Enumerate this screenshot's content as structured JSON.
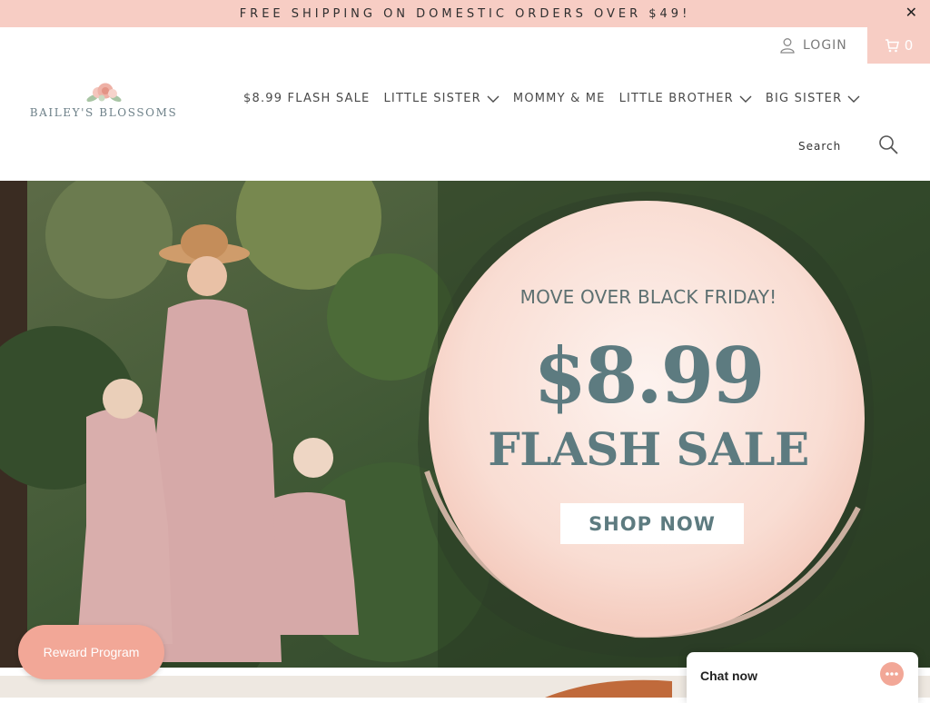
{
  "announcement": {
    "text": "FREE SHIPPING ON DOMESTIC ORDERS OVER $49!",
    "close": "✕"
  },
  "header": {
    "login_label": "LOGIN",
    "cart_count": "0",
    "logo_text": "BAILEY'S BLOSSOMS",
    "search_placeholder": "Search"
  },
  "nav": {
    "items": [
      {
        "label": "$8.99 FLASH SALE",
        "has_dropdown": false
      },
      {
        "label": "LITTLE SISTER",
        "has_dropdown": true
      },
      {
        "label": "MOMMY & ME",
        "has_dropdown": false
      },
      {
        "label": "LITTLE BROTHER",
        "has_dropdown": true
      },
      {
        "label": "BIG SISTER",
        "has_dropdown": true
      }
    ]
  },
  "hero": {
    "kicker": "MOVE OVER BLACK FRIDAY!",
    "price": "$8.99",
    "headline": "FLASH SALE",
    "cta": "SHOP NOW"
  },
  "widgets": {
    "reward_label": "Reward Program",
    "chat_label": "Chat now"
  },
  "colors": {
    "accent_pink": "#f7cdc4",
    "reward_pink": "#f2a797",
    "hero_text": "#5d7b80"
  },
  "icons": [
    "close-icon",
    "user-icon",
    "cart-icon",
    "chevron-down-icon",
    "search-icon",
    "chat-icon"
  ]
}
